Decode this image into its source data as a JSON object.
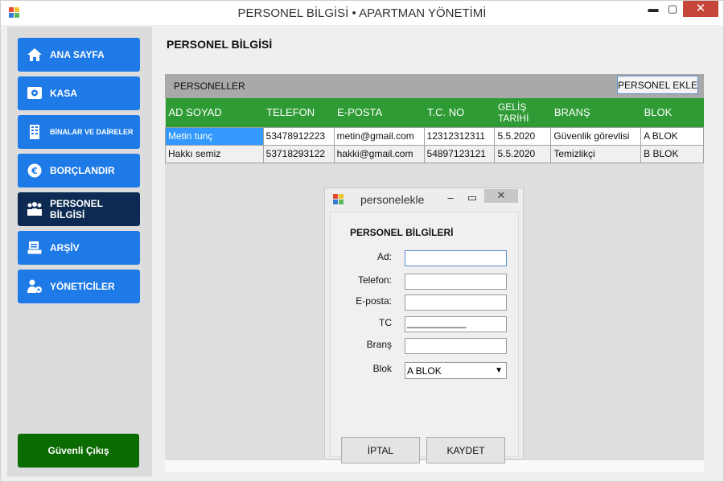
{
  "window": {
    "title": "PERSONEL BİLGİSİ • APARTMAN YÖNETİMİ",
    "minimize": "▬",
    "maximize": "▢",
    "close": "✕"
  },
  "sidebar": {
    "items": [
      {
        "label": "ANA SAYFA",
        "icon": "home-icon"
      },
      {
        "label": "KASA",
        "icon": "safe-icon"
      },
      {
        "label": "BİNALAR VE DAİRELER",
        "icon": "building-icon"
      },
      {
        "label": "BORÇLANDIR",
        "icon": "money-icon"
      },
      {
        "label": "PERSONEL BİLGİSİ",
        "icon": "people-icon"
      },
      {
        "label": "ARŞİV",
        "icon": "archive-icon"
      },
      {
        "label": "YÖNETİCİLER",
        "icon": "admin-icon"
      }
    ],
    "exit_label": "Güvenli Çıkış"
  },
  "main": {
    "page_title": "PERSONEL BİLGİSİ",
    "grid_label": "PERSONELLER",
    "add_button": "PERSONEL EKLE",
    "columns": [
      "AD SOYAD",
      "TELEFON",
      "E-POSTA",
      "T.C. NO",
      "GELİŞ TARİHİ",
      "BRANŞ",
      "BLOK"
    ],
    "rows": [
      [
        "Metin tunç",
        "53478912223",
        "metin@gmail.com",
        "12312312311",
        "5.5.2020",
        "Güvenlik görevlisi",
        "A BLOK"
      ],
      [
        "Hakkı semiz",
        "53718293122",
        "hakki@gmail.com",
        "54897123121",
        "5.5.2020",
        "Temizlikçi",
        "B BLOK"
      ]
    ]
  },
  "dialog": {
    "title": "personelekle",
    "minimize": "–",
    "maximize": "▭",
    "close": "✕",
    "heading": "PERSONEL BİLGİLERİ",
    "labels": {
      "ad": "Ad:",
      "telefon": "Telefon:",
      "eposta": "E-posta:",
      "tc": "TC",
      "brans": "Branş",
      "blok": "Blok"
    },
    "tc_mask": "___________",
    "blok_selected": "A BLOK",
    "cancel": "İPTAL",
    "save": "KAYDET"
  },
  "colors": {
    "nav": "#1e7ae6",
    "nav_active": "#0d2b52",
    "exit": "#0a6b00",
    "grid_header": "#2e9b34",
    "selection": "#3399ff"
  }
}
